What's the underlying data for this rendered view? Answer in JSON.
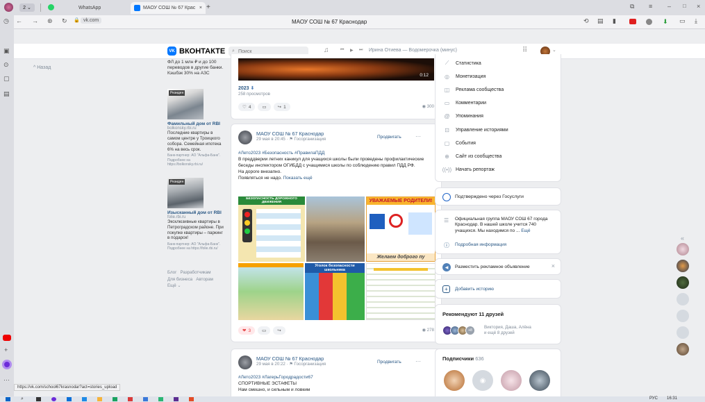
{
  "browser": {
    "tabs": [
      {
        "label": "WhatsApp"
      },
      {
        "label": "МАОУ СОШ № 67 Крас"
      }
    ],
    "tab_count": "2",
    "address": "vk.com",
    "page_title": "МАОУ СОШ № 67 Краснодар",
    "status_url": "https://vk.com/school67krasnodar?act=stories_upload"
  },
  "vk": {
    "logo": "ВКОНТАКТЕ",
    "logo_mark": "VK",
    "search_placeholder": "Поиск",
    "music": "Ирина Отиева — Водомерочка (минус)",
    "back_label": "Назад"
  },
  "ads": {
    "top_text": "ФЛ до 1 млн ₽ и до 100 переводов в другие банки. Кэшбэк 30% на АЗС",
    "ad1": {
      "image_label": "Резиден",
      "title": "Фамильный дом от RBI",
      "domain": "bolkonsky.rbi.ru",
      "text": "Последние квартиры в самом центре у Троицкого собора. Семейная ипотека 6% на весь срок.",
      "legal": "Банк-партнер: АО \"Альфа-Банк\". Подробнее на https://bolkonsky.rbi.ru/"
    },
    "ad2": {
      "image_label": "Резиден",
      "title": "Изысканный дом от RBI",
      "domain": "folie.rbi.ru",
      "text": "Эксклюзивные квартиры в Петроградском районе. При покупке квартиры – паркинг в подарок!",
      "legal": "Банк-партнер: АО \"Альфа-Банк\". Подробнее на https://folie.rbi.ru/"
    },
    "footer": [
      "Блог",
      "Разработчикам",
      "Для бизнеса",
      "Авторам",
      "Ещё"
    ]
  },
  "video": {
    "duration": "0:12",
    "title": "2023",
    "views": "258 просмотров",
    "likes": "4",
    "reposts": "1",
    "eye_views": "300"
  },
  "post1": {
    "author": "МАОУ СОШ № 67 Краснодар",
    "date": "29 мая в 20:45",
    "org": "Госорганизация",
    "promote": "Продвигать",
    "hashtags": "#Лето2023 #Безопасность #ПравилаПДД",
    "text": "В преддверии летних каникул для учащихся школы были проведены профилактические беседы инспектором ОГИБДД с учащимися школы по соблюдению правил ПДД РФ.",
    "text2": "На дороге внезапно.",
    "text3": "Появляться не надо.",
    "more": "Показать ещё",
    "poster1_title": "БЕЗОПАСНОСТЬ ДОРОЖНОГО ДВИЖЕНИЯ",
    "poster3_title": "УВАЖАЕМЫЕ РОДИТЕЛИ!",
    "poster3_sub": "Желаем доброго пу",
    "poster4_title": "Уголок безопасности школьника",
    "likes": "3",
    "views": "278"
  },
  "post2": {
    "author": "МАОУ СОШ № 67 Краснодар",
    "date": "29 мая в 20:22",
    "org": "Госорганизация",
    "promote": "Продвигать",
    "hashtags": "#Лето2023 #ЛагерьГородрадости67",
    "title": "СПОРТИВНЫЕ ЭСТАФЕТЫ",
    "text": "Нам смешно, и сильным и ловким"
  },
  "menu": {
    "items": [
      "Статистика",
      "Монетизация",
      "Реклама сообщества",
      "Комментарии",
      "Упоминания",
      "Управление историями",
      "События",
      "Сайт из сообщества",
      "Начать репортаж"
    ]
  },
  "gosuslugi": "Подтверждено через Госуслуги",
  "about": {
    "text": "Официальная группа МАОУ СОШ 67 города Краснодар. В нашей школе учится 740 учащихся. Мы находимся по ...",
    "more": "Ещё",
    "details": "Подробная информация"
  },
  "ad_offer": "Разместить рекламное объявление",
  "add_story": "Добавить историю",
  "friends": {
    "title": "Рекомендуют 11 друзей",
    "names": "Виктория, Даша, Алёна",
    "more": "и ещё 8 друзей",
    "extra_count": "+8"
  },
  "subscribers": {
    "title": "Подписчики",
    "count": "636"
  },
  "system": {
    "lang": "РУС",
    "time": "16:31"
  }
}
